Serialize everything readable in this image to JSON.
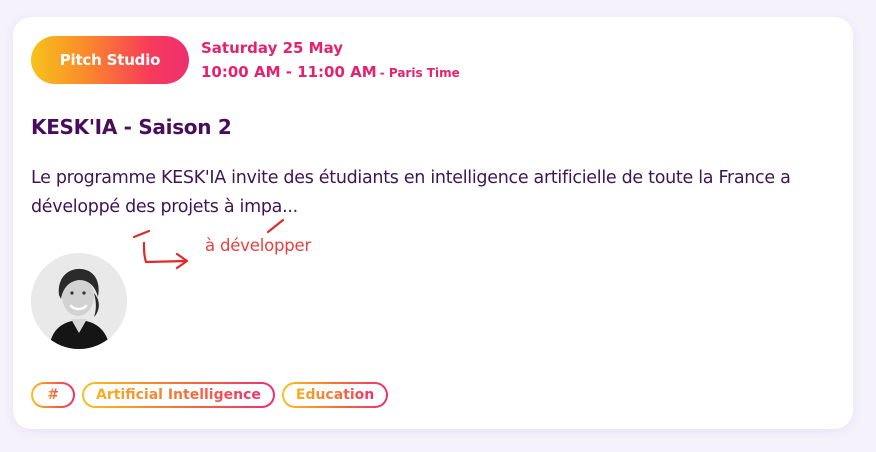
{
  "event": {
    "studio": "Pitch Studio",
    "date": "Saturday 25 May",
    "time": "10:00 AM - 11:00 AM",
    "timezone": "- Paris Time",
    "title": "KESK'IA - Saison 2",
    "description": "Le programme KESK'IA invite des étudiants en intelligence artificielle de toute la France a développé des projets à impa...",
    "correction": "à développer"
  },
  "tags": [
    "#",
    "Artificial Intelligence",
    "Education"
  ],
  "colors": {
    "accent_pink": "#e5226c",
    "title_purple": "#4a0d5c",
    "gradient_yellow": "#f7c21c",
    "gradient_red": "#ec2f70",
    "annotation_red": "#e8413e"
  },
  "icons": {
    "avatar": "speaker-portrait-photo",
    "annotation": "handwritten-correction-arrow"
  }
}
